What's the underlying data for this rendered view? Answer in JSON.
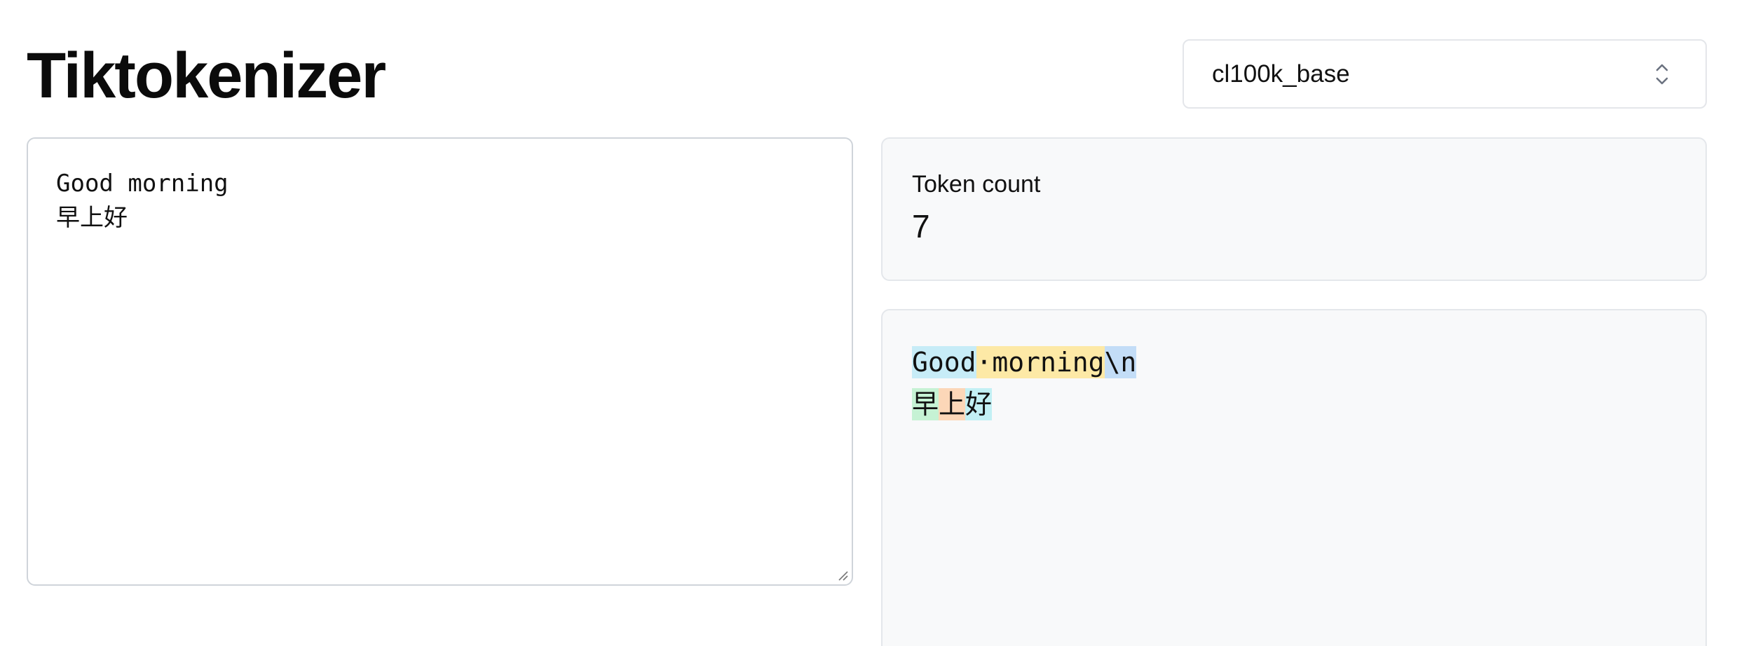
{
  "header": {
    "title": "Tiktokenizer"
  },
  "encoding_select": {
    "selected": "cl100k_base"
  },
  "input": {
    "text": "Good morning\n早上好"
  },
  "token_count": {
    "label": "Token count",
    "value": "7"
  },
  "tokens": {
    "lines": [
      [
        {
          "text": "Good",
          "color": "#c7ecf7"
        },
        {
          "text": "·morning",
          "color": "#fde9a6"
        },
        {
          "text": "\\n",
          "color": "#c3ddf7"
        }
      ],
      [
        {
          "text": "早",
          "color": "#c6f2d4"
        },
        {
          "text": "上",
          "color": "#fcd7b8"
        },
        {
          "text": "好",
          "color": "#c2f0f4"
        }
      ]
    ]
  },
  "icons": {
    "select_chevron": "chevron-up-down-icon",
    "resize": "resize-grip-icon"
  }
}
